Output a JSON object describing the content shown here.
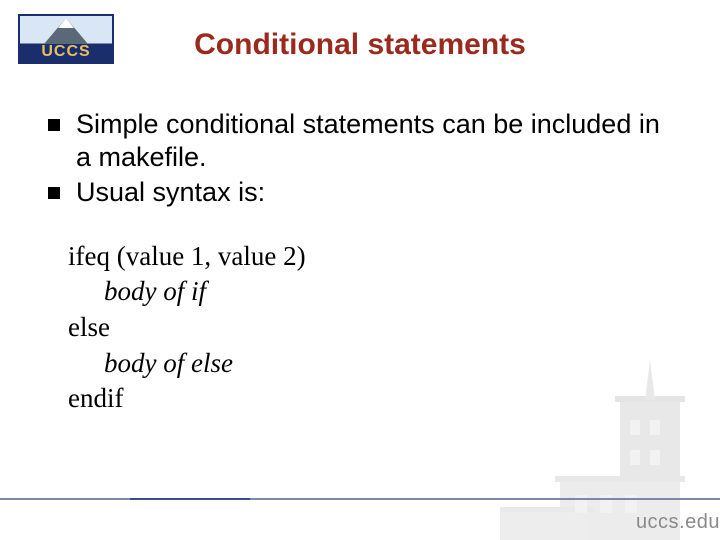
{
  "logo": {
    "text": "UCCS"
  },
  "title": "Conditional statements",
  "bullets": [
    "Simple conditional statements can be included in a makefile.",
    "Usual syntax is:"
  ],
  "code": {
    "l1": "ifeq (value 1, value 2)",
    "l2": "body of if",
    "l3": "else",
    "l4": "body of else",
    "l5": "endif"
  },
  "footer": {
    "url": "uccs.edu"
  }
}
